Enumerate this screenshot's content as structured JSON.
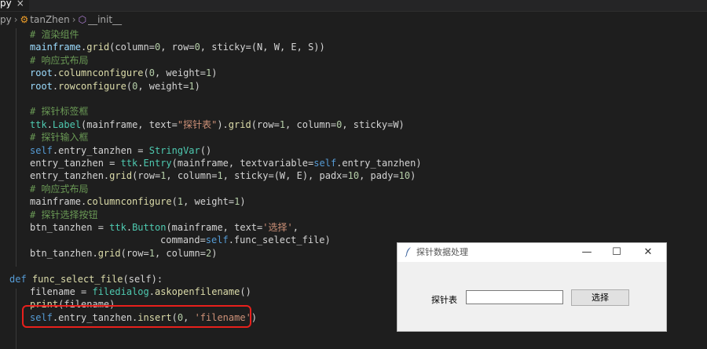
{
  "tab": {
    "label": "py",
    "close_icon": "×"
  },
  "breadcrumb": {
    "file": "py",
    "class_name": "tanZhen",
    "method_name": "__init__"
  },
  "code": {
    "l1": "# 渲染组件",
    "l2_recv": "mainframe",
    "l2_fn": "grid",
    "l2_a": "(column=",
    "l2_n1": "0",
    "l2_b": ", row=",
    "l2_n2": "0",
    "l2_c": ", sticky=(N, W, E, S))",
    "l3": "# 响应式布局",
    "l4_recv": "root",
    "l4_fn": "columnconfigure",
    "l4_a": "(",
    "l4_n1": "0",
    "l4_b": ", weight=",
    "l4_n2": "1",
    "l4_c": ")",
    "l5_recv": "root",
    "l5_fn": "rowconfigure",
    "l5_a": "(",
    "l5_n1": "0",
    "l5_b": ", weight=",
    "l5_n2": "1",
    "l5_c": ")",
    "l7": "# 探针标签框",
    "l8_mod": "ttk",
    "l8_cls": "Label",
    "l8_a": "(mainframe, text=",
    "l8_str": "\"探针表\"",
    "l8_b": ").",
    "l8_fn": "grid",
    "l8_c": "(row=",
    "l8_n1": "1",
    "l8_d": ", column=",
    "l8_n2": "0",
    "l8_e": ", sticky=W)",
    "l9": "# 探针输入框",
    "l10_self": "self",
    "l10_a": ".entry_tanzhen = ",
    "l10_cls": "StringVar",
    "l10_b": "()",
    "l11_a": "entry_tanzhen = ",
    "l11_mod": "ttk",
    "l11_cls": "Entry",
    "l11_b": "(mainframe, textvariable=",
    "l11_self": "self",
    "l11_c": ".entry_tanzhen)",
    "l12_a": "entry_tanzhen.",
    "l12_fn": "grid",
    "l12_b": "(row=",
    "l12_n1": "1",
    "l12_c": ", column=",
    "l12_n2": "1",
    "l12_d": ", sticky=(W, E), padx=",
    "l12_n3": "10",
    "l12_e": ", pady=",
    "l12_n4": "10",
    "l12_f": ")",
    "l13": "# 响应式布局",
    "l14_a": "mainframe.",
    "l14_fn": "columnconfigure",
    "l14_b": "(",
    "l14_n1": "1",
    "l14_c": ", weight=",
    "l14_n2": "1",
    "l14_d": ")",
    "l15": "# 探针选择按钮",
    "l16_a": "btn_tanzhen = ",
    "l16_mod": "ttk",
    "l16_cls": "Button",
    "l16_b": "(mainframe, text=",
    "l16_str": "'选择'",
    "l16_c": ",",
    "l17_a": "command=",
    "l17_self": "self",
    "l17_b": ".func_select_file)",
    "l18_a": "btn_tanzhen.",
    "l18_fn": "grid",
    "l18_b": "(row=",
    "l18_n1": "1",
    "l18_c": ", column=",
    "l18_n2": "2",
    "l18_d": ")",
    "l20_kw": "def",
    "l20_fn": "func_select_file",
    "l20_a": "(self):",
    "l21_a": "filename = ",
    "l21_mod": "filedialog",
    "l21_b": ".",
    "l21_fn": "askopenfilename",
    "l21_c": "()",
    "l22_fn": "print",
    "l22_a": "(filename)",
    "l23_self": "self",
    "l23_a": ".entry_tanzhen.",
    "l23_fn": "insert",
    "l23_b": "(",
    "l23_n1": "0",
    "l23_c": ", ",
    "l23_str": "'filename'",
    "l23_d": ")"
  },
  "dialog": {
    "title": "探针数据处理",
    "minimize": "—",
    "maximize": "☐",
    "close": "✕",
    "label": "探针表",
    "entry_value": "",
    "button_label": "选择"
  },
  "colors": {
    "highlight_border": "#e8201c",
    "editor_bg": "#1e1e1e"
  }
}
